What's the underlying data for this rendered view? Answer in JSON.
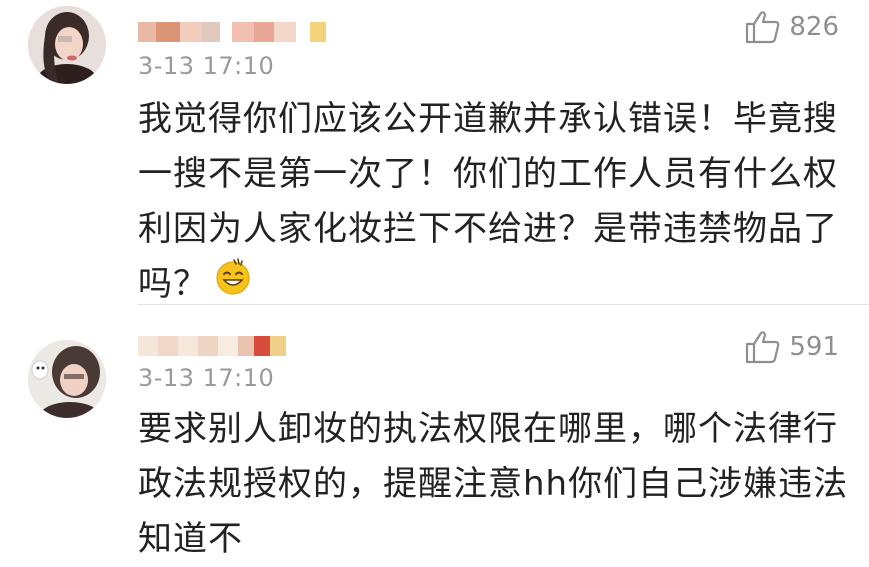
{
  "comments": [
    {
      "timestamp": "3-13 17:10",
      "likes": "826",
      "lines": [
        "我觉得你们应该公开道歉并承认错误！毕竟搜",
        "一搜不是第一次了！你们的工作人员有什么权",
        "利因为人家化妆拦下不给进？是带违禁物品了",
        "吗？"
      ],
      "emoji": "smile-sweat-emoji"
    },
    {
      "timestamp": "3-13 17:10",
      "likes": "591",
      "lines": [
        "要求别人卸妆的执法权限在哪里，哪个法律行",
        "政法规授权的，提醒注意hh你们自己涉嫌违法",
        "知道不"
      ]
    }
  ],
  "colors": {
    "timestamp": "#9a9a9a",
    "body_text": "#222222",
    "like_icon": "#8f8f8f",
    "divider": "#e4e4e4"
  },
  "icons": {
    "like": "thumbs-up-icon"
  }
}
